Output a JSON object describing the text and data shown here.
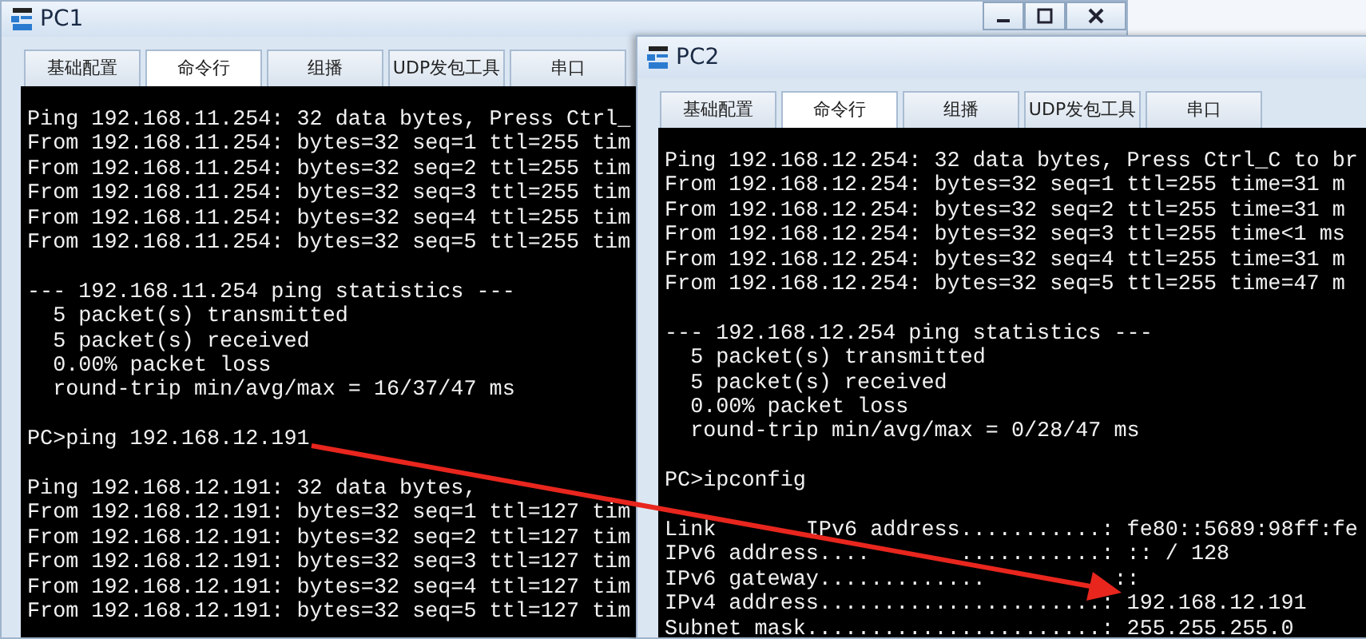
{
  "windows": [
    {
      "title": "PC1",
      "tabs": [
        {
          "label": "基础配置",
          "selected": false
        },
        {
          "label": "命令行",
          "selected": true
        },
        {
          "label": "组播",
          "selected": false
        },
        {
          "label": "UDP发包工具",
          "selected": false
        },
        {
          "label": "串口",
          "selected": false
        }
      ],
      "console": {
        "blocks": [
          [
            "Ping 192.168.11.254: 32 data bytes, Press Ctrl_",
            "From 192.168.11.254: bytes=32 seq=1 ttl=255 tim",
            "From 192.168.11.254: bytes=32 seq=2 ttl=255 tim",
            "From 192.168.11.254: bytes=32 seq=3 ttl=255 tim",
            "From 192.168.11.254: bytes=32 seq=4 ttl=255 tim",
            "From 192.168.11.254: bytes=32 seq=5 ttl=255 tim"
          ],
          [
            "--- 192.168.11.254 ping statistics ---",
            "  5 packet(s) transmitted",
            "  5 packet(s) received",
            "  0.00% packet loss",
            "  round-trip min/avg/max = 16/37/47 ms"
          ],
          [
            "PC>ping 192.168.12.191"
          ],
          [
            "Ping 192.168.12.191: 32 data bytes,",
            "From 192.168.12.191: bytes=32 seq=1 ttl=127 tim",
            "From 192.168.12.191: bytes=32 seq=2 ttl=127 tim",
            "From 192.168.12.191: bytes=32 seq=3 ttl=127 tim",
            "From 192.168.12.191: bytes=32 seq=4 ttl=127 tim",
            "From 192.168.12.191: bytes=32 seq=5 ttl=127 tim"
          ]
        ]
      }
    },
    {
      "title": "PC2",
      "tabs": [
        {
          "label": "基础配置",
          "selected": false
        },
        {
          "label": "命令行",
          "selected": true
        },
        {
          "label": "组播",
          "selected": false
        },
        {
          "label": "UDP发包工具",
          "selected": false
        },
        {
          "label": "串口",
          "selected": false
        }
      ],
      "console": {
        "blocks": [
          [
            "Ping 192.168.12.254: 32 data bytes, Press Ctrl_C to br",
            "From 192.168.12.254: bytes=32 seq=1 ttl=255 time=31 m",
            "From 192.168.12.254: bytes=32 seq=2 ttl=255 time=31 m",
            "From 192.168.12.254: bytes=32 seq=3 ttl=255 time<1 ms",
            "From 192.168.12.254: bytes=32 seq=4 ttl=255 time=31 m",
            "From 192.168.12.254: bytes=32 seq=5 ttl=255 time=47 m"
          ],
          [
            "--- 192.168.12.254 ping statistics ---",
            "  5 packet(s) transmitted",
            "  5 packet(s) received",
            "  0.00% packet loss",
            "  round-trip min/avg/max = 0/28/47 ms"
          ],
          [
            "PC>ipconfig"
          ],
          [
            "Link       IPv6 address...........: fe80::5689:98ff:fe",
            "IPv6 address....       ...........: :: / 128",
            "IPv6 gateway.............          ::",
            "IPv4 address......................: 192.168.12.191",
            "Subnet mask.......................: 255.255.255.0"
          ]
        ]
      }
    }
  ]
}
